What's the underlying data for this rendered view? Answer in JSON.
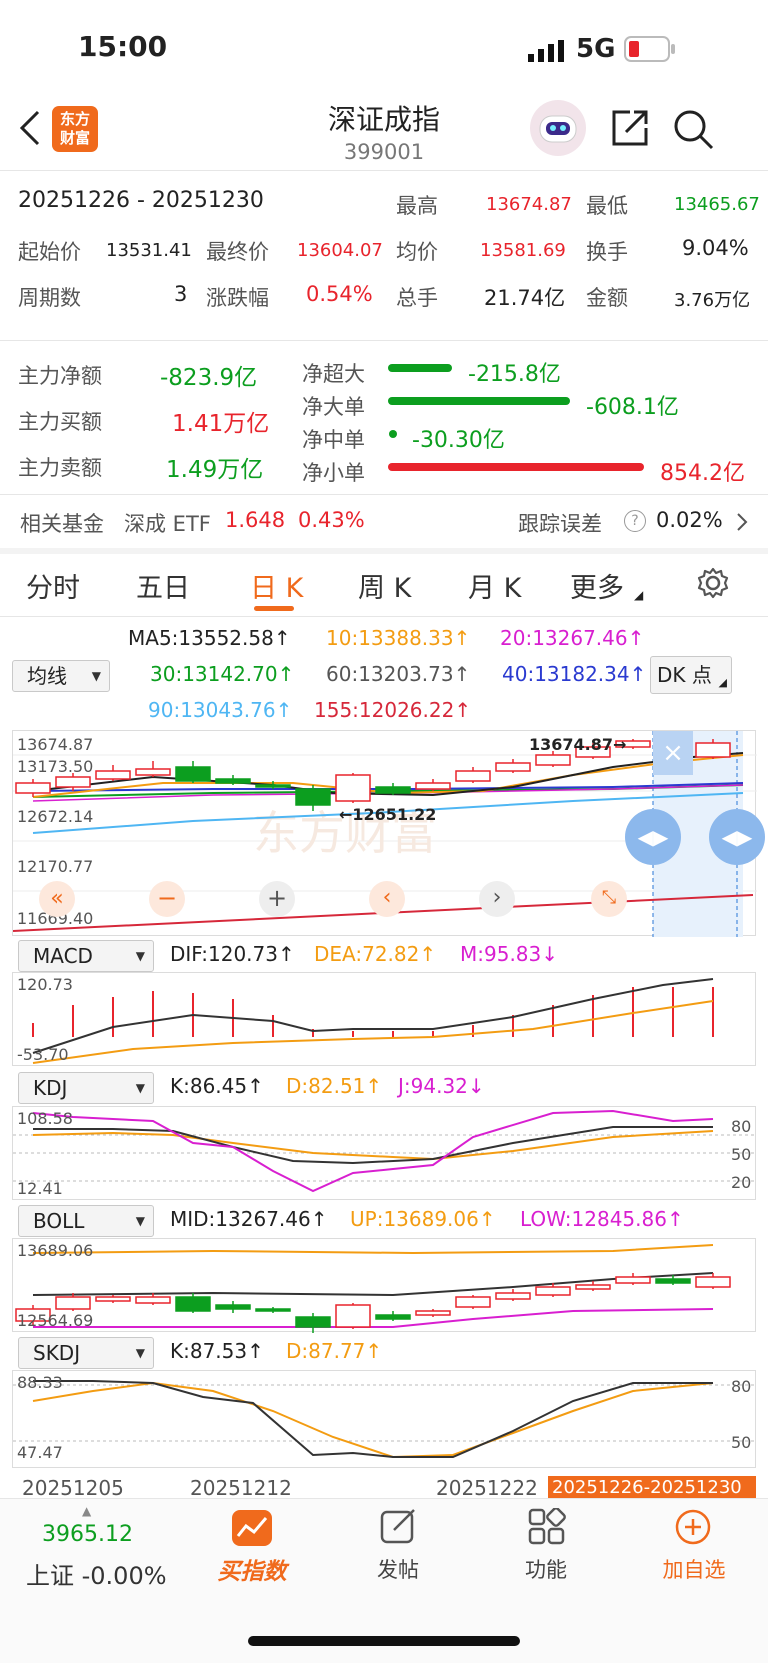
{
  "status_bar": {
    "time": "15:00",
    "network": "5G"
  },
  "header": {
    "title": "深证成指",
    "code": "399001",
    "logo_text_1": "东方",
    "logo_text_2": "财富"
  },
  "stats": {
    "date_range": "20251226  -  20251230",
    "high_label": "最高",
    "high_value": "13674.87",
    "low_label": "最低",
    "low_value": "13465.67",
    "start_label": "起始价",
    "start_value": "13531.41",
    "end_label": "最终价",
    "end_value": "13604.07",
    "avg_label": "均价",
    "avg_value": "13581.69",
    "turnover_label": "换手",
    "turnover_value": "9.04%",
    "periods_label": "周期数",
    "periods_value": "3",
    "change_label": "涨跌幅",
    "change_value": "0.54%",
    "volume_label": "总手",
    "volume_value": "21.74亿",
    "amount_label": "金额",
    "amount_value": "3.76万亿"
  },
  "flows": {
    "net_label": "主力净额",
    "net_value": "-823.9亿",
    "buy_label": "主力买额",
    "buy_value": "1.41万亿",
    "sell_label": "主力卖额",
    "sell_value": "1.49万亿",
    "items": [
      {
        "label": "净超大",
        "value": "-215.8亿"
      },
      {
        "label": "净大单",
        "value": "-608.1亿"
      },
      {
        "label": "净中单",
        "value": "-30.30亿"
      },
      {
        "label": "净小单",
        "value": "854.2亿"
      }
    ]
  },
  "fund": {
    "label": "相关基金",
    "name": "深成 ETF",
    "price": "1.648",
    "change": "0.43%",
    "err_label": "跟踪误差",
    "err_value": "0.02%"
  },
  "tabs": [
    "分时",
    "五日",
    "日 K",
    "周 K",
    "月 K",
    "更多"
  ],
  "ma": {
    "ma5": "MA5:13552.58↑",
    "ma10": "10:13388.33↑",
    "ma20": "20:13267.46↑",
    "ma30": "30:13142.70↑",
    "ma60": "60:13203.73↑",
    "ma40": "40:13182.34↑",
    "ma90": "90:13043.76↑",
    "ma155": "155:12026.22↑",
    "select_label": "均线",
    "dk_label": "DK 点"
  },
  "kchart": {
    "y1": "13674.87",
    "y2": "13173.50",
    "y3": "12672.14",
    "y4": "12170.77",
    "y5": "11669.40",
    "high_mark": "13674.87",
    "low_mark": "12651.22",
    "watermark": "东方财富"
  },
  "macd": {
    "select": "MACD",
    "dif": "DIF:120.73↑",
    "dea": "DEA:72.82↑",
    "m": "M:95.83↓",
    "y_top": "120.73",
    "y_bot": "-53.70"
  },
  "kdj": {
    "select": "KDJ",
    "k": "K:86.45↑",
    "d": "D:82.51↑",
    "j": "J:94.32↓",
    "y_top": "108.58",
    "y_bot": "12.41",
    "r80": "80",
    "r50": "50",
    "r20": "20"
  },
  "boll": {
    "select": "BOLL",
    "mid": "MID:13267.46↑",
    "up": "UP:13689.06↑",
    "low": "LOW:12845.86↑",
    "y_top": "13689.06",
    "y_bot": "12564.69"
  },
  "skdj": {
    "select": "SKDJ",
    "k": "K:87.53↑",
    "d": "D:87.77↑",
    "y_top": "88.33",
    "y_bot": "47.47",
    "r80": "80",
    "r50": "50"
  },
  "xaxis": {
    "d1": "20251205",
    "d2": "20251212",
    "d3": "20251222",
    "range": "20251226-20251230"
  },
  "bottom_nav": {
    "index_value": "3965.12",
    "index_label": "上证 -0.00%",
    "buy_label": "买指数",
    "post_label": "发帖",
    "func_label": "功能",
    "add_label": "加自选"
  },
  "colors": {
    "up": "#e8242c",
    "down": "#0c9e1f",
    "accent": "#f06a1c"
  }
}
